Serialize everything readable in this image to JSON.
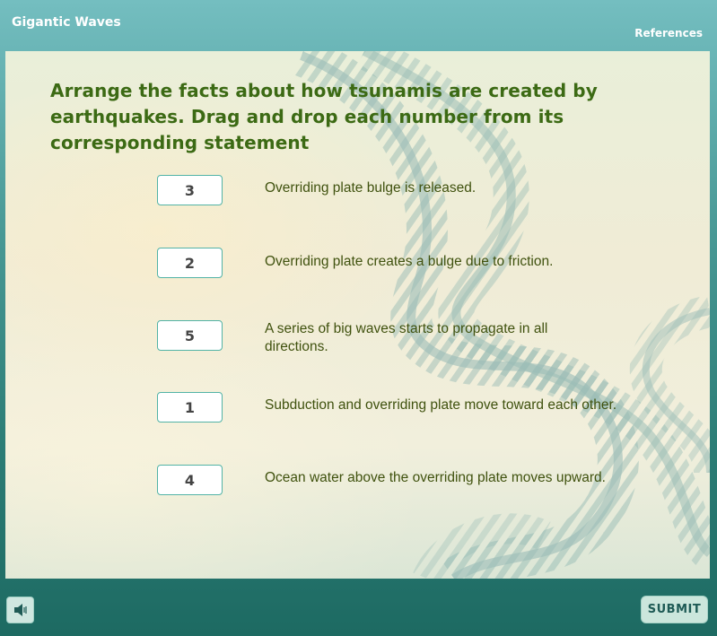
{
  "header": {
    "title": "Gigantic Waves",
    "references_label": "References"
  },
  "question": {
    "prompt": "Arrange the facts about how tsunamis are created by earthquakes. Drag and drop each number from its corresponding statement"
  },
  "items": [
    {
      "number": "3",
      "statement": "Overriding plate bulge is released."
    },
    {
      "number": "2",
      "statement": "Overriding plate creates a bulge due to friction."
    },
    {
      "number": "5",
      "statement": "A series of big waves starts to propagate in all directions."
    },
    {
      "number": "1",
      "statement": "Subduction and overriding plate move toward each other."
    },
    {
      "number": "4",
      "statement": "Ocean water above the overriding plate moves upward."
    }
  ],
  "footer": {
    "submit_label": "SUBMIT",
    "audio_icon": "speaker-icon"
  },
  "colors": {
    "question_text": "#3c6a14",
    "statement_text": "#40520f",
    "box_border": "#52b3a6",
    "header_bg": "#74bec0",
    "footer_bg": "#1d6a62"
  }
}
